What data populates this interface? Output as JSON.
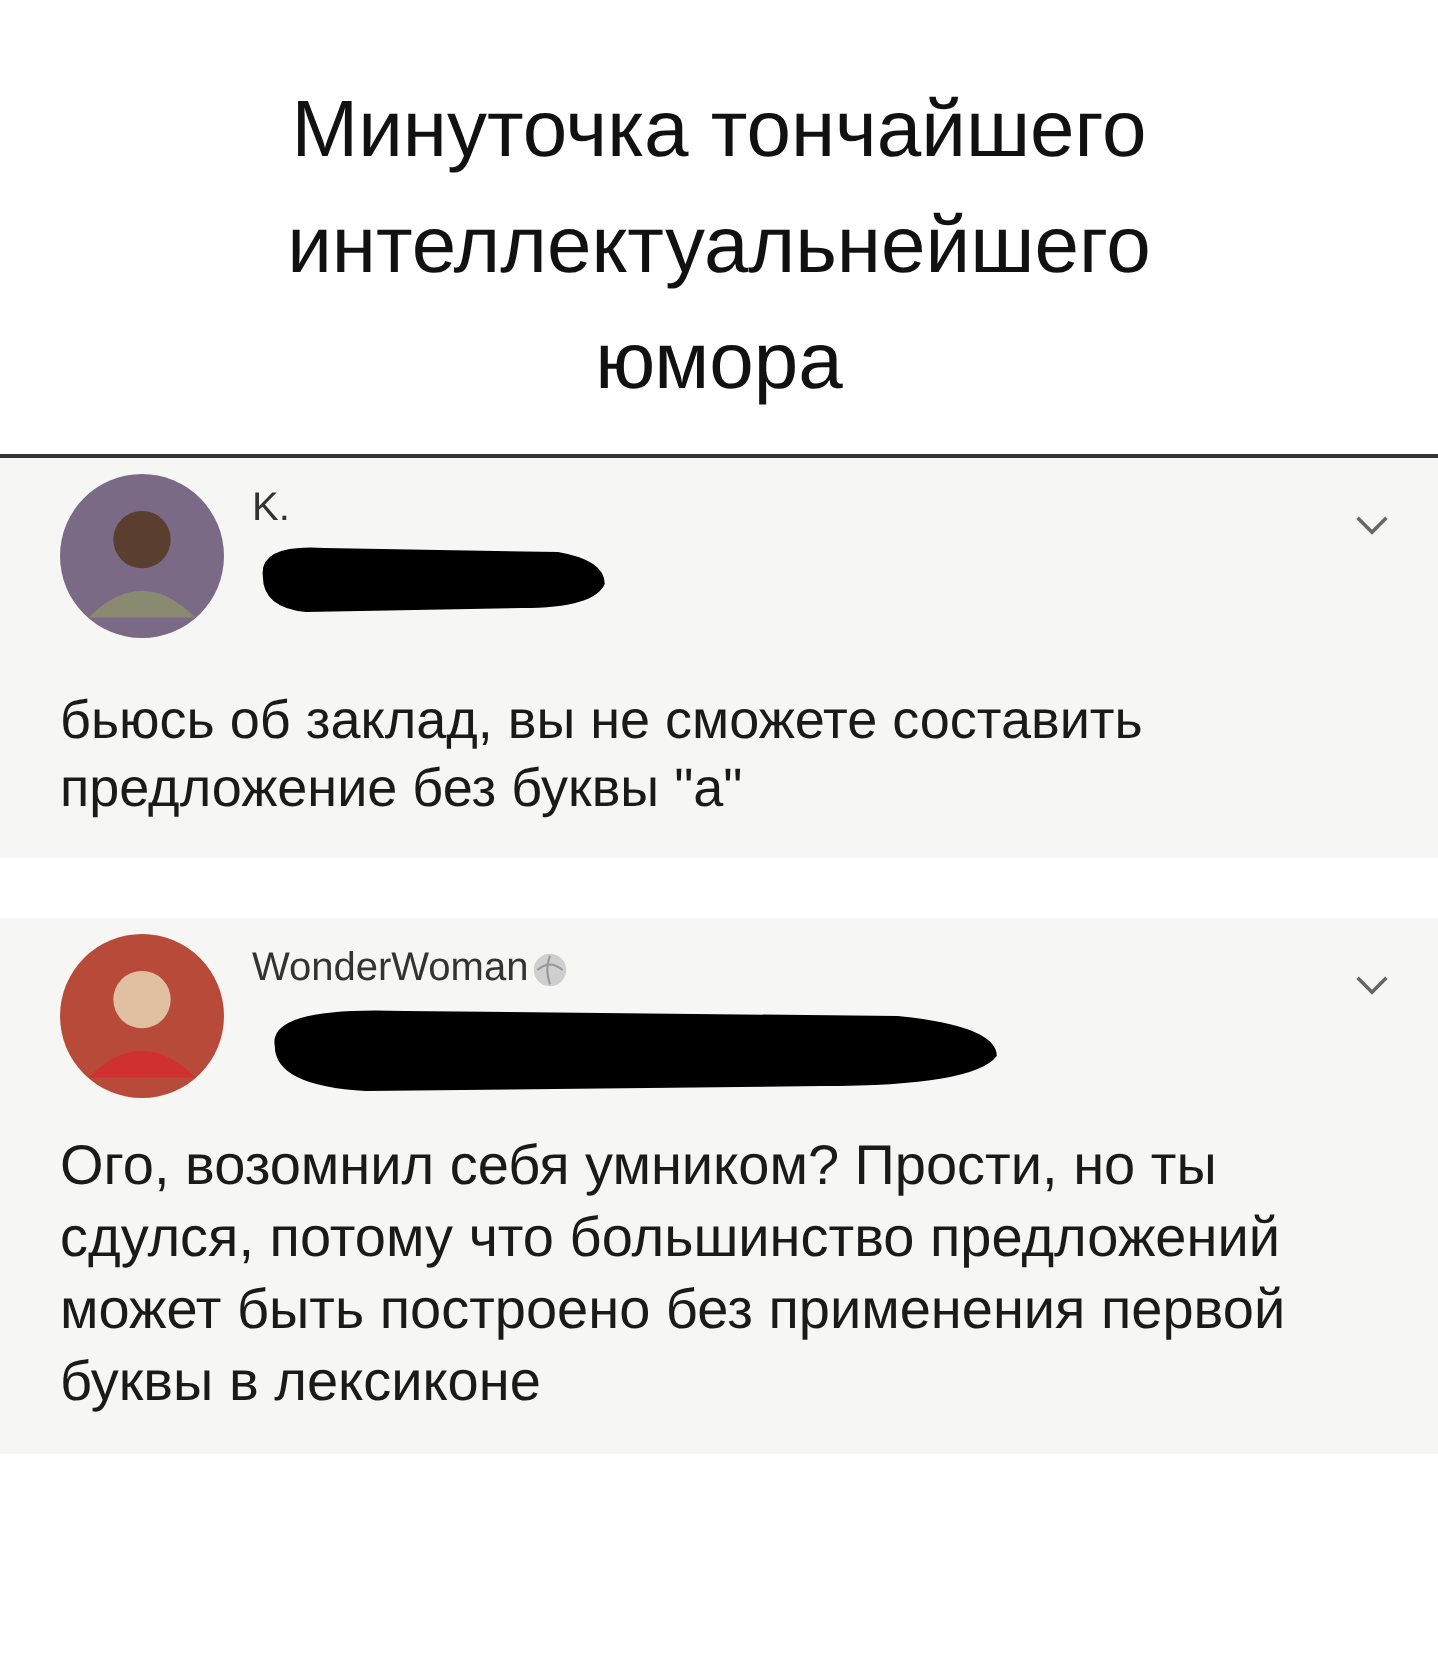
{
  "caption": "Минуточка тончайшего интеллектуальнейшего юмора",
  "posts": [
    {
      "author": "K.",
      "verified": false,
      "text": "бьюсь об заклад, вы не сможете составить предложение без буквы \"а\""
    },
    {
      "author": "WonderWoman",
      "verified": true,
      "text": "Ого, возомнил себя умником? Прости, но ты сдулся, потому что большинство предложений может быть построено без применения первой буквы в лексиконе"
    }
  ]
}
